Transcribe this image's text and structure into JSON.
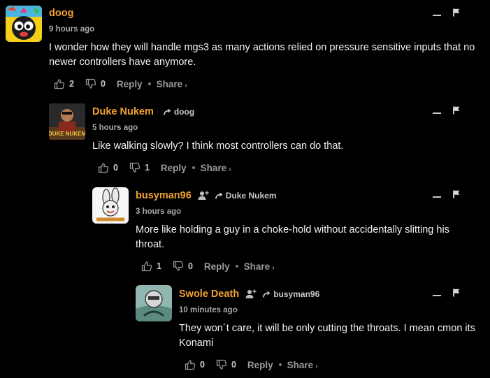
{
  "comments": [
    {
      "author": "doog",
      "reply_to": "",
      "time": "9 hours ago",
      "body": "I wonder how they will handle mgs3 as many actions relied on pressure sensitive inputs that no newer controllers have anymore.",
      "upvotes": "2",
      "downvotes": "0",
      "reply_label": "Reply",
      "share_label": "Share",
      "share_chevron": "›"
    },
    {
      "author": "Duke Nukem",
      "reply_to": "doog",
      "time": "5 hours ago",
      "body": "Like walking slowly? I think most controllers can do that.",
      "upvotes": "0",
      "downvotes": "1",
      "reply_label": "Reply",
      "share_label": "Share",
      "share_chevron": "›",
      "avatar_text": "DUKE NUKEM"
    },
    {
      "author": "busyman96",
      "reply_to": "Duke Nukem",
      "time": "3 hours ago",
      "body": "More like holding a guy in a choke-hold without accidentally slitting his throat.",
      "upvotes": "1",
      "downvotes": "0",
      "reply_label": "Reply",
      "share_label": "Share",
      "share_chevron": "›"
    },
    {
      "author": "Swole Death",
      "reply_to": "busyman96",
      "time": "10 minutes ago",
      "body": "They won´t care, it will be only cutting the throats. I mean cmon its Konami",
      "upvotes": "0",
      "downvotes": "0",
      "reply_label": "Reply",
      "share_label": "Share",
      "share_chevron": "›"
    }
  ],
  "icons": {
    "thumbs_up": "thumbs-up-icon",
    "thumbs_down": "thumbs-down-icon",
    "reply_arrow": "reply-arrow-icon",
    "follow": "follow-user-icon",
    "collapse": "collapse-icon",
    "flag": "flag-icon"
  },
  "colors": {
    "background": "#000000",
    "author": "#f0a231",
    "text": "#f2f2f2",
    "muted": "#9a9a9a"
  }
}
